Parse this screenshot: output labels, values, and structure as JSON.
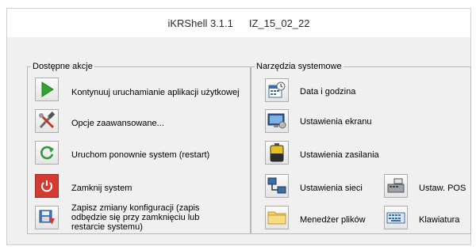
{
  "title": {
    "app": "iKRShell 3.1.1",
    "build": "IZ_15_02_22"
  },
  "actions": {
    "legend": "Dostępne akcje",
    "items": [
      {
        "label": "Kontynuuj uruchamianie aplikacji użytkowej",
        "icon": "play-icon"
      },
      {
        "label": "Opcje zaawansowane...",
        "icon": "tools-icon"
      },
      {
        "label": "Uruchom ponownie system (restart)",
        "icon": "restart-icon"
      },
      {
        "label": "Zamknij system",
        "icon": "power-icon"
      },
      {
        "label": "Zapisz zmiany konfiguracji (zapis odbędzie się przy zamknięciu lub restarcie systemu)",
        "icon": "save-config-icon"
      }
    ]
  },
  "tools": {
    "legend": "Narzędzia systemowe",
    "items": [
      {
        "label": "Data i godzina",
        "icon": "calendar-clock-icon"
      },
      {
        "label": "Ustawienia ekranu",
        "icon": "display-settings-icon"
      },
      {
        "label": "Ustawienia zasilania",
        "icon": "battery-icon"
      },
      {
        "label": "Ustawienia sieci",
        "icon": "network-icon"
      },
      {
        "label": "Ustaw. POS",
        "icon": "cash-register-icon"
      },
      {
        "label": "Menedżer plików",
        "icon": "folder-icon"
      },
      {
        "label": "Klawiatura",
        "icon": "keyboard-icon"
      }
    ]
  },
  "colors": {
    "play": "#2fa52f",
    "power": "#d23b2f",
    "restart": "#2e9a3a"
  }
}
